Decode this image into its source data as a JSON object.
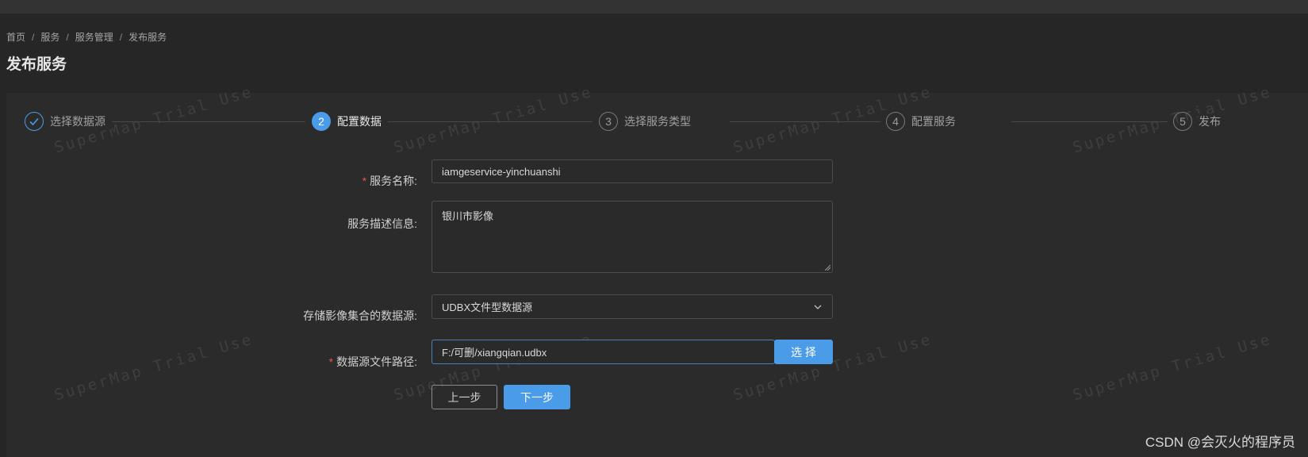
{
  "breadcrumb": {
    "items": [
      "首页",
      "服务",
      "服务管理",
      "发布服务"
    ],
    "separator": "/"
  },
  "page": {
    "title": "发布服务"
  },
  "steps": [
    {
      "index": "1",
      "label": "选择数据源",
      "status": "done"
    },
    {
      "index": "2",
      "label": "配置数据",
      "status": "active"
    },
    {
      "index": "3",
      "label": "选择服务类型",
      "status": "pending"
    },
    {
      "index": "4",
      "label": "配置服务",
      "status": "pending"
    },
    {
      "index": "5",
      "label": "发布",
      "status": "pending"
    }
  ],
  "form": {
    "service_name": {
      "label": "服务名称:",
      "required": true,
      "value": "iamgeservice-yinchuanshi"
    },
    "service_desc": {
      "label": "服务描述信息:",
      "value": "银川市影像"
    },
    "datasource": {
      "label": "存储影像集合的数据源:",
      "value": "UDBX文件型数据源"
    },
    "file_path": {
      "label": "数据源文件路径:",
      "required": true,
      "value": "F:/可删/xiangqian.udbx",
      "button": "选 择"
    }
  },
  "actions": {
    "prev": "上一步",
    "next": "下一步"
  },
  "watermark": "SuperMap Trial Use",
  "credit": "CSDN @会灭火的程序员",
  "colors": {
    "background": "#262626",
    "panel": "#2b2b2b",
    "accent": "#4a9ce8",
    "required": "#e5534b"
  }
}
